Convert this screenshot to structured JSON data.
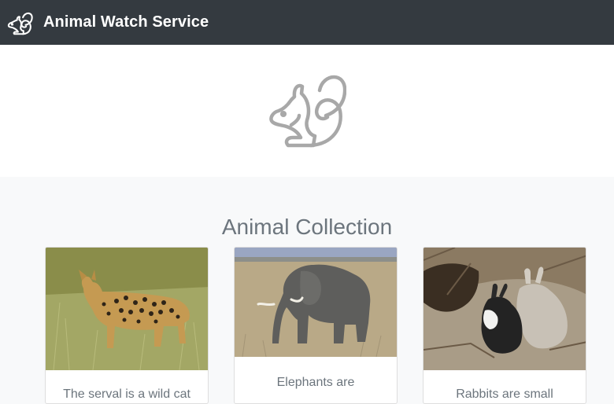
{
  "navbar": {
    "brand": "Animal Watch Service",
    "logo_icon": "squirrel-icon"
  },
  "hero": {
    "icon": "squirrel-icon"
  },
  "collection": {
    "title": "Animal Collection",
    "cards": [
      {
        "image": "serval-photo",
        "text": "The serval is a wild cat"
      },
      {
        "image": "elephant-photo",
        "text": "Elephants are"
      },
      {
        "image": "rabbits-photo",
        "text": "Rabbits are small"
      }
    ]
  },
  "colors": {
    "navbar_bg": "#343a40",
    "page_bg": "#f8f9fa",
    "muted_text": "#6c757d",
    "hero_icon": "#a8a8a8"
  }
}
